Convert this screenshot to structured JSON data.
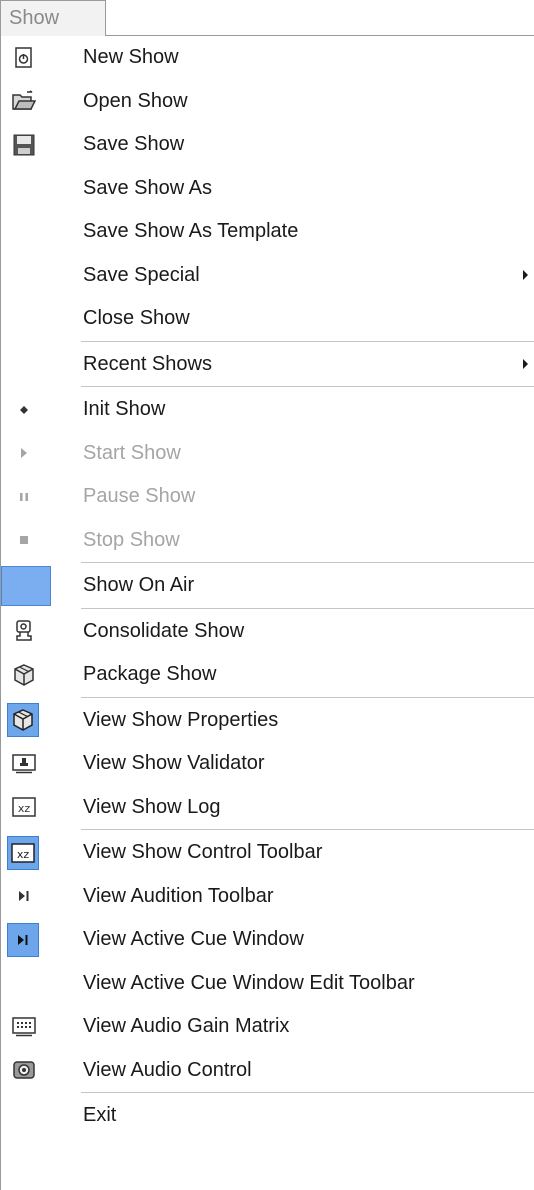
{
  "menu_title": "Show",
  "items": {
    "new_show": "New Show",
    "open_show": "Open Show",
    "save_show": "Save Show",
    "save_show_as": "Save Show As",
    "save_show_as_template": "Save Show As Template",
    "save_special": "Save Special",
    "close_show": "Close Show",
    "recent_shows": "Recent Shows",
    "init_show": "Init Show",
    "start_show": "Start Show",
    "pause_show": "Pause Show",
    "stop_show": "Stop Show",
    "show_on_air": "Show On Air",
    "consolidate_show": "Consolidate Show",
    "package_show": "Package Show",
    "view_show_properties": "View Show Properties",
    "view_show_validator": "View Show Validator",
    "view_show_log": "View Show Log",
    "view_show_control_toolbar": "View Show Control Toolbar",
    "view_audition_toolbar": "View Audition Toolbar",
    "view_active_cue_window": "View Active Cue Window",
    "view_active_cue_window_edit_toolbar": "View Active Cue Window Edit Toolbar",
    "view_audio_gain_matrix": "View Audio Gain Matrix",
    "view_audio_control": "View Audio Control",
    "exit": "Exit"
  },
  "icon_names": {
    "new_show": "new-document-icon",
    "open_show": "open-folder-icon",
    "save_show": "floppy-disk-icon",
    "init_show": "bullet-icon",
    "start_show": "play-icon",
    "pause_show": "pause-icon",
    "stop_show": "stop-icon",
    "show_on_air": "on-air-indicator-icon",
    "consolidate_show": "consolidate-icon",
    "package_show": "package-icon",
    "view_show_properties": "package-icon",
    "view_show_validator": "validator-icon",
    "view_show_log": "log-icon",
    "view_show_control_toolbar": "log-icon",
    "view_audition_toolbar": "play-to-end-icon",
    "view_active_cue_window": "play-to-end-icon",
    "view_audio_gain_matrix": "gain-matrix-icon",
    "view_audio_control": "audio-control-icon"
  },
  "colors": {
    "checked_bg": "#6ea6ec",
    "disabled_text": "#a5a5a5"
  }
}
